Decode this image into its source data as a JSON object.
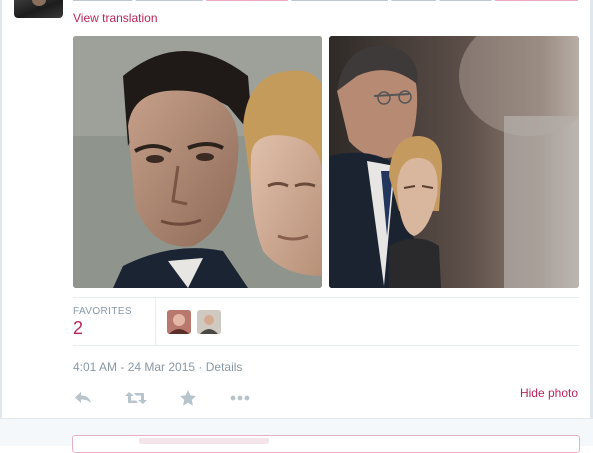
{
  "tweet": {
    "view_translation": "View translation"
  },
  "stats": {
    "favorites_label": "FAVORITES",
    "favorites_count": "2"
  },
  "meta": {
    "timestamp": "4:01 AM - 24 Mar 2015",
    "separator": " · ",
    "details": "Details"
  },
  "actions": {
    "hide_photo": "Hide photo",
    "icons": [
      "reply-icon",
      "retweet-icon",
      "favorite-icon",
      "more-icon"
    ]
  },
  "colors": {
    "accent": "#b8255c",
    "muted": "#8899a6",
    "divider": "#e8edf0"
  }
}
